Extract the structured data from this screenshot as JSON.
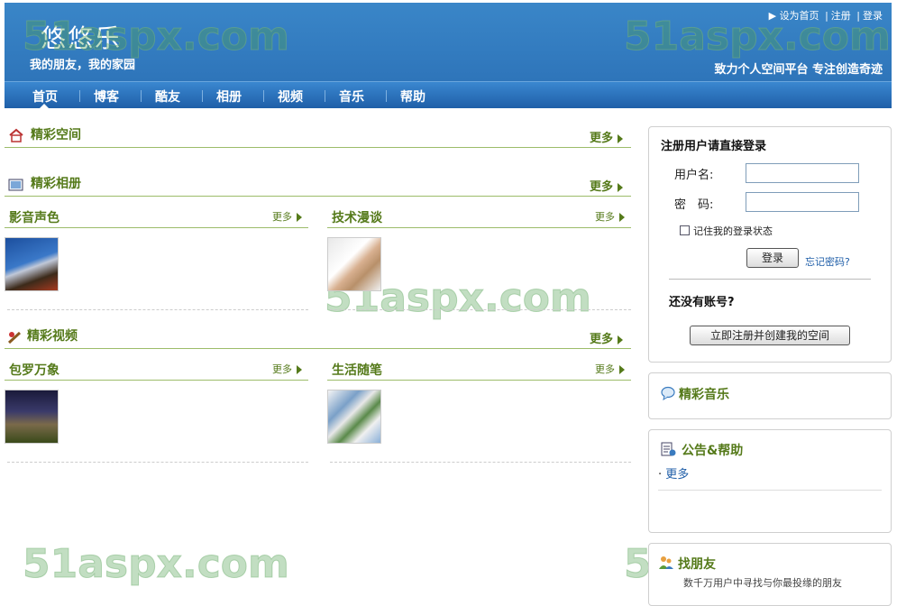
{
  "header": {
    "logo": "悠悠乐",
    "slogan": "我的朋友，我的家园",
    "tagline": "致力个人空间平台  专注创造奇迹",
    "links": [
      "设为首页",
      "注册",
      "登录"
    ]
  },
  "nav": [
    "首页",
    "博客",
    "酷友",
    "相册",
    "视频",
    "音乐",
    "帮助"
  ],
  "watermark": "51aspx.com",
  "sections": {
    "space": {
      "title": "精彩空间",
      "more": "更多"
    },
    "album": {
      "title": "精彩相册",
      "more": "更多",
      "cats": [
        {
          "title": "影音声色",
          "more": "更多"
        },
        {
          "title": "技术漫谈",
          "more": "更多"
        }
      ]
    },
    "video": {
      "title": "精彩视频",
      "more": "更多",
      "cats": [
        {
          "title": "包罗万象",
          "more": "更多"
        },
        {
          "title": "生活随笔",
          "more": "更多"
        }
      ]
    }
  },
  "login": {
    "title": "注册用户请直接登录",
    "username_label": "用户名:",
    "password_label": "密　码:",
    "remember": "记住我的登录状态",
    "login_button": "登录",
    "forgot": "忘记密码?",
    "no_account": "还没有账号?",
    "register_button": "立即注册并创建我的空间"
  },
  "music": {
    "title": "精彩音乐"
  },
  "notice": {
    "title": "公告&帮助",
    "more": "更多"
  },
  "friends": {
    "title": "找朋友",
    "desc": "数千万用户中寻找与你最投缘的朋友"
  }
}
